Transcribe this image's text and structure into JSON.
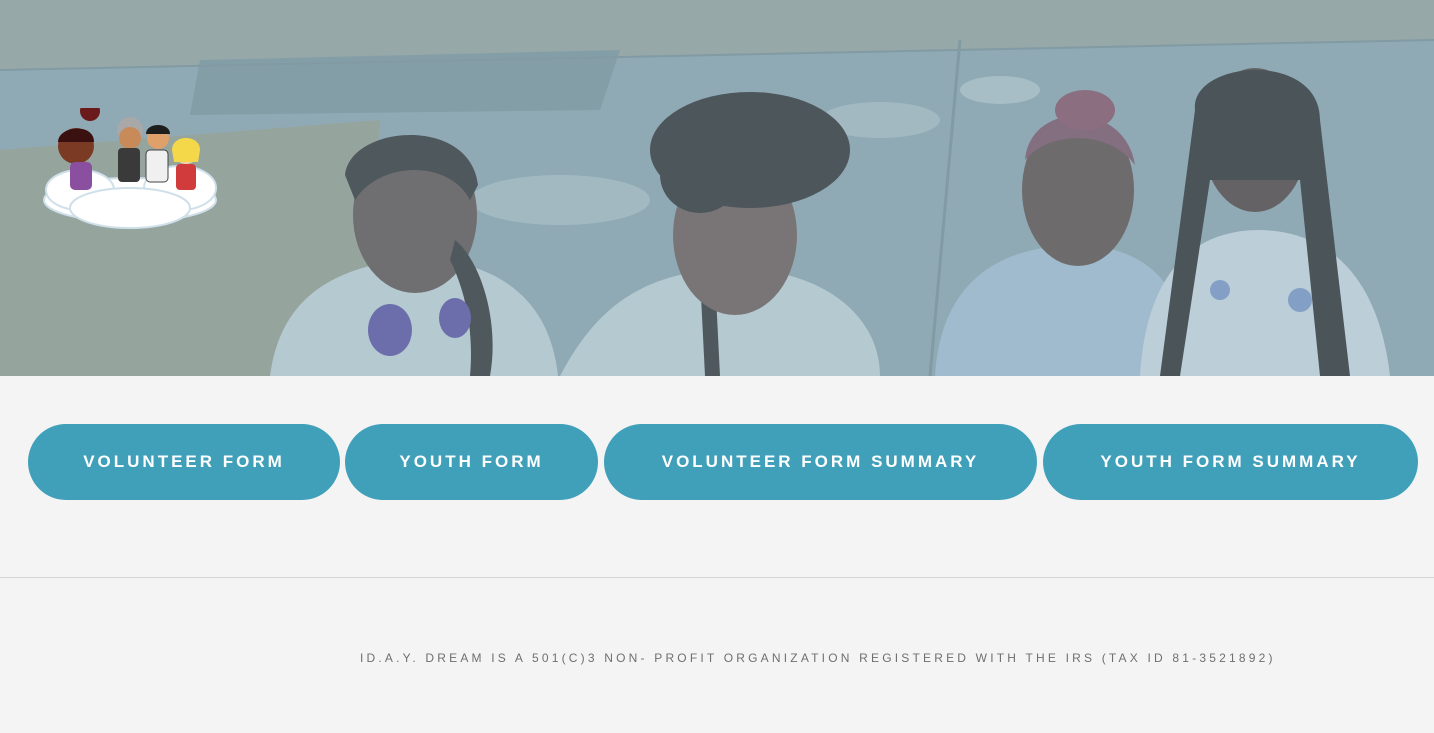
{
  "hero": {
    "logo": "cartoon-kids-on-cloud-logo"
  },
  "buttons": {
    "volunteer_form": "VOLUNTEER FORM",
    "youth_form": "YOUTH FORM",
    "volunteer_form_summary": "VOLUNTEER FORM SUMMARY",
    "youth_form_summary": "YOUTH FORM SUMMARY"
  },
  "footer": {
    "text": "ID.A.Y. DREAM IS A 501(C)3 NON- PROFIT ORGANIZATION REGISTERED WITH THE IRS (TAX ID 81-3521892)"
  },
  "colors": {
    "button": "#40a0b9",
    "page_bg": "#f4f4f4",
    "hero_overlay": "#8fb3bf"
  }
}
